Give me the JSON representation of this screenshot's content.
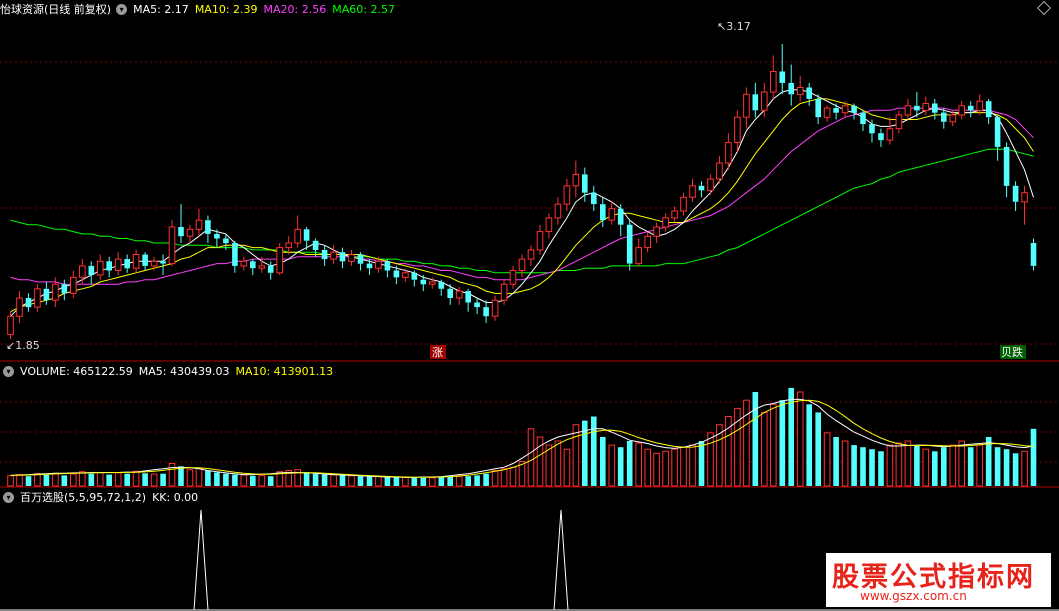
{
  "header": {
    "title": "怡球资源(日线 前复权)",
    "ma": [
      {
        "label": "MA5: 2.17",
        "color": "#ffffff"
      },
      {
        "label": "MA10: 2.39",
        "color": "#ffff00"
      },
      {
        "label": "MA20: 2.56",
        "color": "#ff40ff"
      },
      {
        "label": "MA60: 2.57",
        "color": "#00ff00"
      }
    ]
  },
  "main": {
    "high_label": "3.17",
    "low_label": "1.85",
    "up_marker": "涨",
    "down_marker": "跌",
    "down_prefix": "贝",
    "colors": {
      "up": "#ff3030",
      "down": "#54ffff",
      "bg": "#000000",
      "grid": "#800000"
    }
  },
  "volume": {
    "label": "VOLUME: 465122.59",
    "ma5": "MA5: 430439.03",
    "ma10": "MA10: 413901.13"
  },
  "indicator": {
    "label": "百万选股(5,5,95,72,1,2)",
    "kk": "KK: 0.00"
  },
  "watermark": {
    "line1": "股票公式指标网",
    "line2": "www.gszx.com.cn"
  },
  "chart_data": {
    "type": "candlestick",
    "candles": [
      [
        1.9,
        1.98,
        1.88,
        2.0
      ],
      [
        1.98,
        2.06,
        1.95,
        2.09
      ],
      [
        2.06,
        2.02,
        2.0,
        2.08
      ],
      [
        2.02,
        2.1,
        2.0,
        2.12
      ],
      [
        2.1,
        2.05,
        2.03,
        2.13
      ],
      [
        2.05,
        2.12,
        2.02,
        2.15
      ],
      [
        2.12,
        2.08,
        2.05,
        2.14
      ],
      [
        2.08,
        2.15,
        2.06,
        2.18
      ],
      [
        2.15,
        2.2,
        2.12,
        2.23
      ],
      [
        2.2,
        2.16,
        2.12,
        2.22
      ],
      [
        2.16,
        2.22,
        2.14,
        2.25
      ],
      [
        2.22,
        2.18,
        2.15,
        2.24
      ],
      [
        2.18,
        2.23,
        2.16,
        2.26
      ],
      [
        2.23,
        2.19,
        2.17,
        2.25
      ],
      [
        2.19,
        2.25,
        2.17,
        2.27
      ],
      [
        2.25,
        2.2,
        2.18,
        2.26
      ],
      [
        2.2,
        2.22,
        2.18,
        2.24
      ],
      [
        2.22,
        2.21,
        2.16,
        2.25
      ],
      [
        2.21,
        2.37,
        2.2,
        2.4
      ],
      [
        2.37,
        2.33,
        2.3,
        2.47
      ],
      [
        2.33,
        2.36,
        2.3,
        2.38
      ],
      [
        2.36,
        2.4,
        2.33,
        2.45
      ],
      [
        2.4,
        2.34,
        2.3,
        2.42
      ],
      [
        2.34,
        2.32,
        2.28,
        2.36
      ],
      [
        2.32,
        2.3,
        2.27,
        2.34
      ],
      [
        2.3,
        2.2,
        2.17,
        2.31
      ],
      [
        2.2,
        2.22,
        2.18,
        2.24
      ],
      [
        2.22,
        2.19,
        2.16,
        2.23
      ],
      [
        2.19,
        2.2,
        2.17,
        2.24
      ],
      [
        2.2,
        2.17,
        2.14,
        2.22
      ],
      [
        2.17,
        2.28,
        2.16,
        2.3
      ],
      [
        2.28,
        2.3,
        2.25,
        2.33
      ],
      [
        2.3,
        2.36,
        2.28,
        2.42
      ],
      [
        2.36,
        2.31,
        2.27,
        2.37
      ],
      [
        2.31,
        2.27,
        2.24,
        2.32
      ],
      [
        2.27,
        2.23,
        2.2,
        2.29
      ],
      [
        2.23,
        2.26,
        2.21,
        2.29
      ],
      [
        2.26,
        2.22,
        2.19,
        2.28
      ],
      [
        2.22,
        2.25,
        2.2,
        2.27
      ],
      [
        2.25,
        2.21,
        2.18,
        2.26
      ],
      [
        2.21,
        2.19,
        2.16,
        2.23
      ],
      [
        2.19,
        2.22,
        2.17,
        2.24
      ],
      [
        2.22,
        2.18,
        2.15,
        2.23
      ],
      [
        2.18,
        2.15,
        2.12,
        2.2
      ],
      [
        2.15,
        2.17,
        2.13,
        2.19
      ],
      [
        2.17,
        2.14,
        2.11,
        2.18
      ],
      [
        2.14,
        2.12,
        2.09,
        2.16
      ],
      [
        2.12,
        2.13,
        2.1,
        2.15
      ],
      [
        2.13,
        2.1,
        2.07,
        2.14
      ],
      [
        2.1,
        2.06,
        2.03,
        2.12
      ],
      [
        2.06,
        2.09,
        2.03,
        2.11
      ],
      [
        2.09,
        2.04,
        2.0,
        2.1
      ],
      [
        2.04,
        2.02,
        1.99,
        2.06
      ],
      [
        2.02,
        1.98,
        1.95,
        2.05
      ],
      [
        1.98,
        2.05,
        1.96,
        2.07
      ],
      [
        2.05,
        2.12,
        2.03,
        2.14
      ],
      [
        2.12,
        2.18,
        2.1,
        2.2
      ],
      [
        2.18,
        2.23,
        2.15,
        2.25
      ],
      [
        2.23,
        2.27,
        2.2,
        2.29
      ],
      [
        2.27,
        2.35,
        2.25,
        2.38
      ],
      [
        2.35,
        2.41,
        2.32,
        2.43
      ],
      [
        2.41,
        2.47,
        2.38,
        2.5
      ],
      [
        2.47,
        2.55,
        2.44,
        2.58
      ],
      [
        2.55,
        2.6,
        2.5,
        2.66
      ],
      [
        2.6,
        2.52,
        2.48,
        2.63
      ],
      [
        2.52,
        2.47,
        2.44,
        2.55
      ],
      [
        2.47,
        2.4,
        2.37,
        2.5
      ],
      [
        2.4,
        2.45,
        2.38,
        2.48
      ],
      [
        2.45,
        2.38,
        2.33,
        2.47
      ],
      [
        2.38,
        2.21,
        2.18,
        2.4
      ],
      [
        2.21,
        2.28,
        2.2,
        2.32
      ],
      [
        2.28,
        2.33,
        2.26,
        2.35
      ],
      [
        2.33,
        2.37,
        2.3,
        2.39
      ],
      [
        2.37,
        2.41,
        2.35,
        2.43
      ],
      [
        2.41,
        2.44,
        2.39,
        2.46
      ],
      [
        2.44,
        2.5,
        2.42,
        2.52
      ],
      [
        2.5,
        2.55,
        2.48,
        2.58
      ],
      [
        2.55,
        2.53,
        2.5,
        2.57
      ],
      [
        2.53,
        2.58,
        2.51,
        2.6
      ],
      [
        2.58,
        2.65,
        2.56,
        2.68
      ],
      [
        2.65,
        2.74,
        2.62,
        2.78
      ],
      [
        2.74,
        2.85,
        2.7,
        2.88
      ],
      [
        2.85,
        2.95,
        2.8,
        2.98
      ],
      [
        2.95,
        2.88,
        2.85,
        3.0
      ],
      [
        2.88,
        2.96,
        2.85,
        3.0
      ],
      [
        2.96,
        3.05,
        2.93,
        3.12
      ],
      [
        3.05,
        3.0,
        2.95,
        3.17
      ],
      [
        3.0,
        2.95,
        2.9,
        3.08
      ],
      [
        2.95,
        2.98,
        2.92,
        3.03
      ],
      [
        2.98,
        2.93,
        2.9,
        3.0
      ],
      [
        2.93,
        2.85,
        2.82,
        2.95
      ],
      [
        2.85,
        2.89,
        2.83,
        2.9
      ],
      [
        2.89,
        2.87,
        2.84,
        2.91
      ],
      [
        2.87,
        2.9,
        2.85,
        2.92
      ],
      [
        2.9,
        2.87,
        2.84,
        2.91
      ],
      [
        2.87,
        2.82,
        2.79,
        2.88
      ],
      [
        2.82,
        2.78,
        2.74,
        2.84
      ],
      [
        2.78,
        2.75,
        2.72,
        2.8
      ],
      [
        2.75,
        2.8,
        2.73,
        2.85
      ],
      [
        2.8,
        2.86,
        2.78,
        2.88
      ],
      [
        2.86,
        2.9,
        2.84,
        2.93
      ],
      [
        2.9,
        2.88,
        2.85,
        2.96
      ],
      [
        2.88,
        2.91,
        2.86,
        2.94
      ],
      [
        2.91,
        2.87,
        2.84,
        2.93
      ],
      [
        2.87,
        2.83,
        2.8,
        2.89
      ],
      [
        2.83,
        2.86,
        2.81,
        2.88
      ],
      [
        2.86,
        2.9,
        2.84,
        2.92
      ],
      [
        2.9,
        2.88,
        2.85,
        2.92
      ],
      [
        2.88,
        2.92,
        2.86,
        2.95
      ],
      [
        2.92,
        2.85,
        2.82,
        2.93
      ],
      [
        2.85,
        2.72,
        2.66,
        2.86
      ],
      [
        2.72,
        2.55,
        2.5,
        2.74
      ],
      [
        2.55,
        2.48,
        2.44,
        2.57
      ],
      [
        2.48,
        2.52,
        2.38,
        2.55
      ],
      [
        2.3,
        2.2,
        2.18,
        2.32
      ]
    ],
    "ma5": [
      1.98,
      2.02,
      2.04,
      2.06,
      2.08,
      2.09,
      2.11,
      2.12,
      2.14,
      2.16,
      2.18,
      2.19,
      2.2,
      2.21,
      2.22,
      2.22,
      2.22,
      2.22,
      2.25,
      2.28,
      2.3,
      2.33,
      2.36,
      2.35,
      2.34,
      2.3,
      2.28,
      2.25,
      2.22,
      2.2,
      2.21,
      2.23,
      2.26,
      2.28,
      2.3,
      2.29,
      2.27,
      2.25,
      2.24,
      2.23,
      2.22,
      2.21,
      2.2,
      2.19,
      2.18,
      2.17,
      2.15,
      2.14,
      2.13,
      2.11,
      2.09,
      2.08,
      2.06,
      2.04,
      2.04,
      2.05,
      2.08,
      2.12,
      2.17,
      2.22,
      2.29,
      2.35,
      2.41,
      2.48,
      2.51,
      2.52,
      2.5,
      2.48,
      2.45,
      2.4,
      2.37,
      2.35,
      2.33,
      2.34,
      2.36,
      2.39,
      2.44,
      2.48,
      2.52,
      2.57,
      2.63,
      2.7,
      2.79,
      2.84,
      2.88,
      2.93,
      2.96,
      2.97,
      2.97,
      2.96,
      2.94,
      2.92,
      2.9,
      2.88,
      2.87,
      2.85,
      2.82,
      2.81,
      2.81,
      2.82,
      2.84,
      2.86,
      2.88,
      2.89,
      2.88,
      2.87,
      2.87,
      2.87,
      2.88,
      2.88,
      2.85,
      2.78,
      2.7,
      2.62,
      2.5
    ],
    "ma10": [
      2.0,
      2.02,
      2.03,
      2.04,
      2.05,
      2.06,
      2.08,
      2.09,
      2.1,
      2.11,
      2.13,
      2.14,
      2.15,
      2.16,
      2.17,
      2.18,
      2.19,
      2.2,
      2.21,
      2.23,
      2.24,
      2.26,
      2.28,
      2.28,
      2.29,
      2.29,
      2.29,
      2.28,
      2.28,
      2.27,
      2.26,
      2.26,
      2.26,
      2.25,
      2.25,
      2.25,
      2.25,
      2.25,
      2.25,
      2.25,
      2.24,
      2.23,
      2.22,
      2.21,
      2.2,
      2.19,
      2.18,
      2.17,
      2.16,
      2.15,
      2.13,
      2.12,
      2.11,
      2.09,
      2.08,
      2.08,
      2.08,
      2.09,
      2.1,
      2.12,
      2.15,
      2.19,
      2.24,
      2.29,
      2.33,
      2.37,
      2.4,
      2.42,
      2.43,
      2.43,
      2.42,
      2.41,
      2.4,
      2.39,
      2.39,
      2.39,
      2.41,
      2.43,
      2.45,
      2.48,
      2.52,
      2.57,
      2.63,
      2.69,
      2.74,
      2.79,
      2.84,
      2.88,
      2.91,
      2.92,
      2.93,
      2.93,
      2.92,
      2.91,
      2.9,
      2.88,
      2.86,
      2.85,
      2.84,
      2.84,
      2.84,
      2.84,
      2.85,
      2.86,
      2.86,
      2.86,
      2.87,
      2.87,
      2.87,
      2.87,
      2.86,
      2.84,
      2.8,
      2.76,
      2.7
    ],
    "ma20": [
      2.15,
      2.14,
      2.14,
      2.13,
      2.13,
      2.13,
      2.12,
      2.12,
      2.12,
      2.12,
      2.12,
      2.12,
      2.12,
      2.13,
      2.13,
      2.14,
      2.14,
      2.15,
      2.16,
      2.17,
      2.18,
      2.19,
      2.2,
      2.21,
      2.21,
      2.22,
      2.22,
      2.23,
      2.23,
      2.23,
      2.23,
      2.23,
      2.24,
      2.24,
      2.24,
      2.24,
      2.24,
      2.24,
      2.24,
      2.23,
      2.23,
      2.22,
      2.22,
      2.21,
      2.21,
      2.2,
      2.2,
      2.19,
      2.18,
      2.18,
      2.17,
      2.16,
      2.15,
      2.15,
      2.14,
      2.14,
      2.14,
      2.14,
      2.15,
      2.16,
      2.17,
      2.18,
      2.2,
      2.22,
      2.24,
      2.26,
      2.28,
      2.3,
      2.32,
      2.33,
      2.34,
      2.35,
      2.36,
      2.37,
      2.38,
      2.39,
      2.4,
      2.41,
      2.42,
      2.44,
      2.46,
      2.49,
      2.52,
      2.55,
      2.58,
      2.62,
      2.66,
      2.7,
      2.73,
      2.76,
      2.79,
      2.81,
      2.83,
      2.85,
      2.86,
      2.87,
      2.88,
      2.88,
      2.88,
      2.89,
      2.89,
      2.89,
      2.89,
      2.89,
      2.89,
      2.88,
      2.88,
      2.88,
      2.88,
      2.88,
      2.87,
      2.86,
      2.84,
      2.8,
      2.76
    ],
    "ma60": [
      2.4,
      2.39,
      2.38,
      2.38,
      2.37,
      2.36,
      2.36,
      2.35,
      2.34,
      2.34,
      2.33,
      2.33,
      2.32,
      2.32,
      2.31,
      2.31,
      2.3,
      2.3,
      2.3,
      2.29,
      2.29,
      2.29,
      2.29,
      2.28,
      2.28,
      2.28,
      2.28,
      2.27,
      2.27,
      2.27,
      2.27,
      2.26,
      2.26,
      2.26,
      2.26,
      2.25,
      2.25,
      2.25,
      2.24,
      2.24,
      2.24,
      2.23,
      2.23,
      2.23,
      2.22,
      2.22,
      2.21,
      2.21,
      2.2,
      2.2,
      2.19,
      2.19,
      2.18,
      2.18,
      2.17,
      2.17,
      2.17,
      2.17,
      2.17,
      2.17,
      2.17,
      2.18,
      2.18,
      2.18,
      2.19,
      2.19,
      2.19,
      2.2,
      2.2,
      2.2,
      2.2,
      2.2,
      2.2,
      2.21,
      2.21,
      2.21,
      2.22,
      2.23,
      2.24,
      2.25,
      2.27,
      2.28,
      2.3,
      2.32,
      2.34,
      2.36,
      2.38,
      2.4,
      2.42,
      2.44,
      2.46,
      2.48,
      2.5,
      2.52,
      2.54,
      2.55,
      2.56,
      2.58,
      2.59,
      2.61,
      2.62,
      2.63,
      2.64,
      2.65,
      2.66,
      2.67,
      2.68,
      2.69,
      2.7,
      2.71,
      2.71,
      2.71,
      2.7,
      2.69,
      2.68
    ],
    "volume": [
      25,
      28,
      24,
      30,
      27,
      31,
      26,
      29,
      35,
      30,
      33,
      28,
      32,
      30,
      36,
      31,
      29,
      30,
      55,
      48,
      40,
      44,
      38,
      33,
      30,
      28,
      27,
      25,
      26,
      24,
      35,
      38,
      40,
      34,
      30,
      28,
      27,
      26,
      25,
      24,
      24,
      23,
      22,
      22,
      21,
      21,
      20,
      20,
      21,
      22,
      23,
      24,
      26,
      30,
      38,
      42,
      46,
      60,
      140,
      120,
      100,
      110,
      90,
      150,
      160,
      170,
      120,
      100,
      95,
      110,
      105,
      90,
      80,
      85,
      90,
      95,
      100,
      110,
      130,
      150,
      170,
      190,
      210,
      230,
      180,
      200,
      210,
      240,
      230,
      200,
      180,
      130,
      120,
      110,
      100,
      95,
      90,
      85,
      100,
      105,
      110,
      98,
      90,
      85,
      95,
      100,
      110,
      95,
      100,
      120,
      95,
      90,
      80,
      85,
      140
    ],
    "vol_ma5": [
      26,
      27,
      28,
      29,
      30,
      31,
      31,
      32,
      32,
      33,
      33,
      33,
      33,
      34,
      34,
      37,
      40,
      42,
      45,
      46,
      45,
      42,
      38,
      35,
      32,
      30,
      28,
      28,
      29,
      30,
      32,
      33,
      33,
      32,
      31,
      29,
      28,
      27,
      26,
      25,
      24,
      23,
      22,
      22,
      21,
      21,
      22,
      22,
      23,
      25,
      28,
      30,
      34,
      38,
      42,
      46,
      55,
      68,
      82,
      98,
      110,
      120,
      125,
      130,
      135,
      140,
      140,
      132,
      122,
      112,
      108,
      104,
      98,
      94,
      92,
      95,
      100,
      107,
      117,
      128,
      142,
      158,
      174,
      188,
      198,
      202,
      208,
      212,
      212,
      208,
      196,
      176,
      160,
      146,
      132,
      122,
      112,
      104,
      98,
      98,
      99,
      100,
      100,
      98,
      96,
      98,
      100,
      102,
      104,
      106,
      104,
      100,
      96,
      94,
      98
    ],
    "kk": [
      0,
      0,
      0,
      0,
      0,
      0,
      0,
      0,
      0,
      0,
      0,
      0,
      0,
      0,
      0,
      0,
      0,
      0,
      0,
      0,
      0,
      0,
      0,
      0,
      0,
      0,
      0,
      0,
      0,
      0,
      0,
      0,
      0,
      0,
      0,
      0,
      0,
      0,
      0,
      0,
      0,
      0,
      0,
      0,
      0,
      0,
      0,
      0,
      0,
      0,
      0,
      0,
      0,
      0,
      0,
      0,
      0,
      0,
      0,
      0,
      0,
      0,
      0,
      0,
      0,
      0,
      0,
      0,
      0,
      0,
      0,
      0,
      0,
      0,
      0,
      0,
      0,
      0,
      0,
      0,
      0,
      0,
      0,
      0,
      0,
      0,
      0,
      0,
      0,
      0,
      0,
      0,
      0,
      0,
      0,
      0,
      0,
      0,
      0,
      0,
      0,
      0,
      0,
      0,
      0,
      0,
      0,
      0,
      0,
      0,
      0,
      0,
      0,
      0,
      0
    ],
    "kk_spikes": [
      1,
      1
    ],
    "ylim": [
      1.85,
      3.17
    ]
  }
}
